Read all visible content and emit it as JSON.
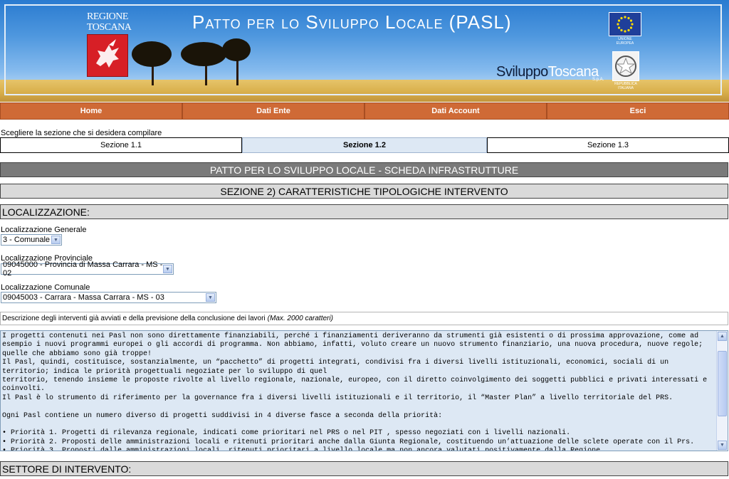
{
  "banner": {
    "region_line1": "REGIONE",
    "region_line2": "TOSCANA",
    "title": "Patto per lo Sviluppo Locale (PASL)",
    "eu_line1": "UNIONE",
    "eu_line2": "EUROPEA",
    "italy_line1": "REPUBBLICA",
    "italy_line2": "ITALIANA",
    "sviluppo_part1": "Sviluppo",
    "sviluppo_part2": "Toscana",
    "spa": "S.p.A."
  },
  "nav": {
    "items": [
      {
        "label": "Home"
      },
      {
        "label": "Dati Ente"
      },
      {
        "label": "Dati Account"
      },
      {
        "label": "Esci"
      }
    ]
  },
  "prompt": "Scegliere la sezione che si desidera compilare",
  "sections": [
    {
      "label": "Sezione 1.1"
    },
    {
      "label": "Sezione 1.2"
    },
    {
      "label": "Sezione 1.3"
    }
  ],
  "main": {
    "title": "PATTO PER LO SVILUPPO LOCALE - SCHEDA INFRASTRUTTURE",
    "subtitle": "SEZIONE 2) CARATTERISTICHE TIPOLOGICHE INTERVENTO",
    "localizzazione_header": "LOCALIZZAZIONE:",
    "generale_label": "Localizzazione Generale",
    "generale_value": "3 - Comunale",
    "provinciale_label": "Localizzazione Provinciale",
    "provinciale_value": "09045000 - Provincia di Massa Carrara - MS - 02",
    "comunale_label": "Localizzazione Comunale",
    "comunale_value": "09045003 - Carrara - Massa Carrara - MS - 03",
    "descrizione_label": "Descrizione degli interventi già avviati e della previsione della conclusione dei lavori",
    "descrizione_hint": "(Max. 2000 caratteri)",
    "descrizione_text": "I progetti contenuti nei Pasl non sono direttamente finanziabili, perché i finanziamenti deriveranno da strumenti già esistenti o di prossima approvazione, come ad esempio i nuovi programmi europei o gli accordi di programma. Non abbiamo, infatti, voluto creare un nuovo strumento finanziario, una nuova procedura, nuove regole; quelle che abbiamo sono già troppe!\nIl Pasl, quindi, costituisce, sostanzialmente, un “pacchetto” di progetti integrati, condivisi fra i diversi livelli istituzionali, economici, sociali di un territorio; indica le priorità progettuali negoziate per lo sviluppo di quel\nterritorio, tenendo insieme le proposte rivolte al livello regionale, nazionale, europeo, con il diretto coinvolgimento dei soggetti pubblici e privati interessati e coinvolti.\nIl Pasl è lo strumento di riferimento per la governance fra i diversi livelli istituzionali e il territorio, il “Master Plan” a livello territoriale del PRS.\n\nOgni Pasl contiene un numero diverso di progetti suddivisi in 4 diverse fasce a seconda della priorità:\n\n• Priorità 1. Progetti di rilevanza regionale, indicati come prioritari nel PRS o nel PIT , spesso negoziati con i livelli nazionali.\n• Priorità 2. Proposti delle amministrazioni locali e ritenuti prioritari anche dalla Giunta Regionale, costituendo un’attuazione delle sclete operate con il Prs.\n• Priorità 3. Proposti dalle amministrazioni locali, ritenuti prioritari a livello locale ma non ancora valutati positivamente dalla Regione.",
    "settore_header": "SETTORE DI INTERVENTO:"
  },
  "colors": {
    "nav_bg": "#cf6a36",
    "active_section_bg": "#dde8f4",
    "dark_bar": "#7a7a7a",
    "light_bar": "#dadada"
  }
}
